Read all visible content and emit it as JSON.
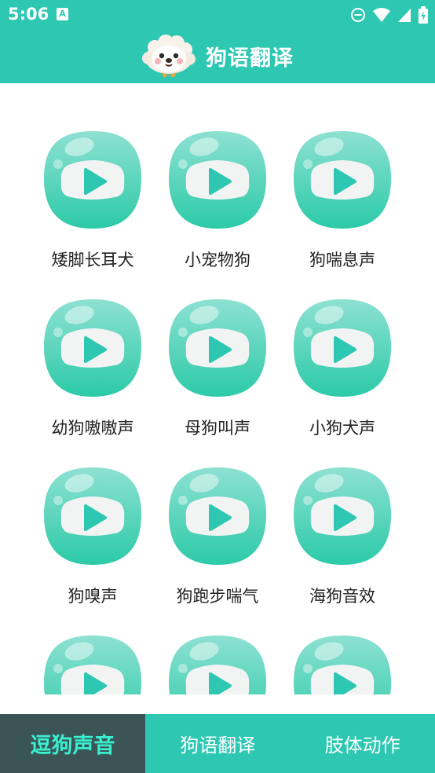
{
  "status_bar": {
    "time": "5:06",
    "notification_letter": "A",
    "icons": [
      "do-not-disturb-icon",
      "wifi-icon",
      "cell-signal-icon",
      "battery-charging-icon"
    ]
  },
  "header": {
    "title": "狗语翻译",
    "logo": "dog-face-logo"
  },
  "sounds": [
    {
      "label": "矮脚长耳犬"
    },
    {
      "label": "小宠物狗"
    },
    {
      "label": "狗喘息声"
    },
    {
      "label": "幼狗嗷嗷声"
    },
    {
      "label": "母狗叫声"
    },
    {
      "label": "小狗犬声"
    },
    {
      "label": "狗嗅声"
    },
    {
      "label": "狗跑步喘气"
    },
    {
      "label": "海狗音效"
    },
    {
      "label": ""
    },
    {
      "label": ""
    },
    {
      "label": ""
    }
  ],
  "bottom_nav": {
    "tabs": [
      {
        "label": "逗狗声音",
        "active": true
      },
      {
        "label": "狗语翻译",
        "active": false
      },
      {
        "label": "肢体动作",
        "active": false
      }
    ]
  },
  "colors": {
    "primary": "#2ec8b2",
    "active_tab_bg": "#3b5456",
    "active_tab_text": "#38f0cf"
  }
}
